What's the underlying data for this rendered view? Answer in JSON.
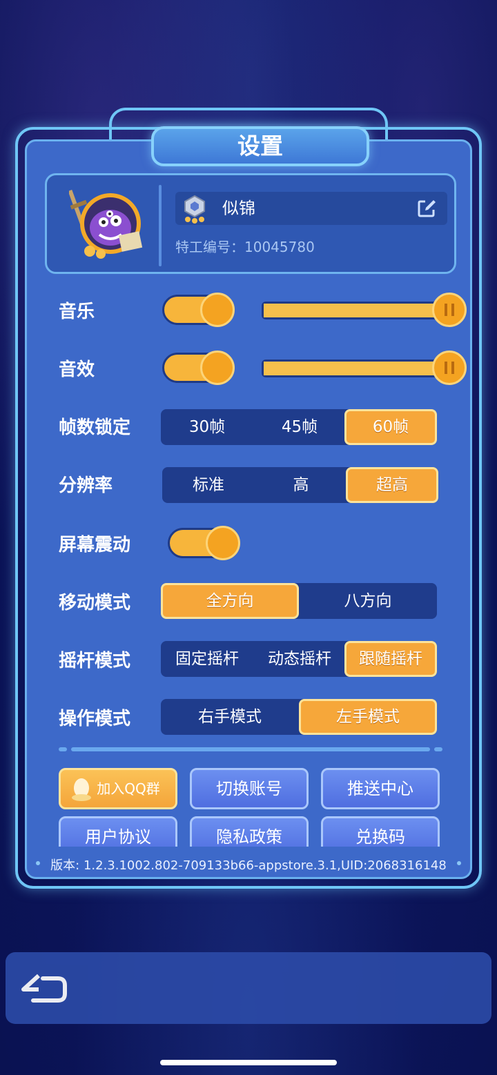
{
  "title": "设置",
  "profile": {
    "name": "似锦",
    "agent_id": "特工编号：10045780",
    "rank_icon": "silver-rank-badge-icon",
    "edit_icon": "edit-icon"
  },
  "settings": {
    "music": {
      "label": "音乐",
      "enabled": true,
      "volume": 1.0
    },
    "sfx": {
      "label": "音效",
      "enabled": true,
      "volume": 1.0
    },
    "fps": {
      "label": "帧数锁定",
      "options": [
        "30帧",
        "45帧",
        "60帧"
      ],
      "selected": "60帧"
    },
    "resolution": {
      "label": "分辨率",
      "options": [
        "标准",
        "高",
        "超高"
      ],
      "selected": "超高"
    },
    "vibration": {
      "label": "屏幕震动",
      "enabled": true
    },
    "move_mode": {
      "label": "移动模式",
      "options": [
        "全方向",
        "八方向"
      ],
      "selected": "全方向"
    },
    "joystick_mode": {
      "label": "摇杆模式",
      "options": [
        "固定摇杆",
        "动态摇杆",
        "跟随摇杆"
      ],
      "selected": "跟随摇杆"
    },
    "operate_mode": {
      "label": "操作模式",
      "options": [
        "右手模式",
        "左手模式"
      ],
      "selected": "左手模式"
    }
  },
  "buttons": {
    "join_qq": "加入QQ群",
    "switch_account": "切换账号",
    "push_center": "推送中心",
    "user_agreement": "用户协议",
    "privacy_policy": "隐私政策",
    "redeem_code": "兑换码"
  },
  "version": "版本: 1.2.3.1002.802-709133b66-appstore.3.1,UID:2068316148",
  "colors": {
    "accent": "#f6a73a",
    "panel": "#3d69c9",
    "frame": "#6fc6f6"
  },
  "back_icon": "back-arrow-icon"
}
